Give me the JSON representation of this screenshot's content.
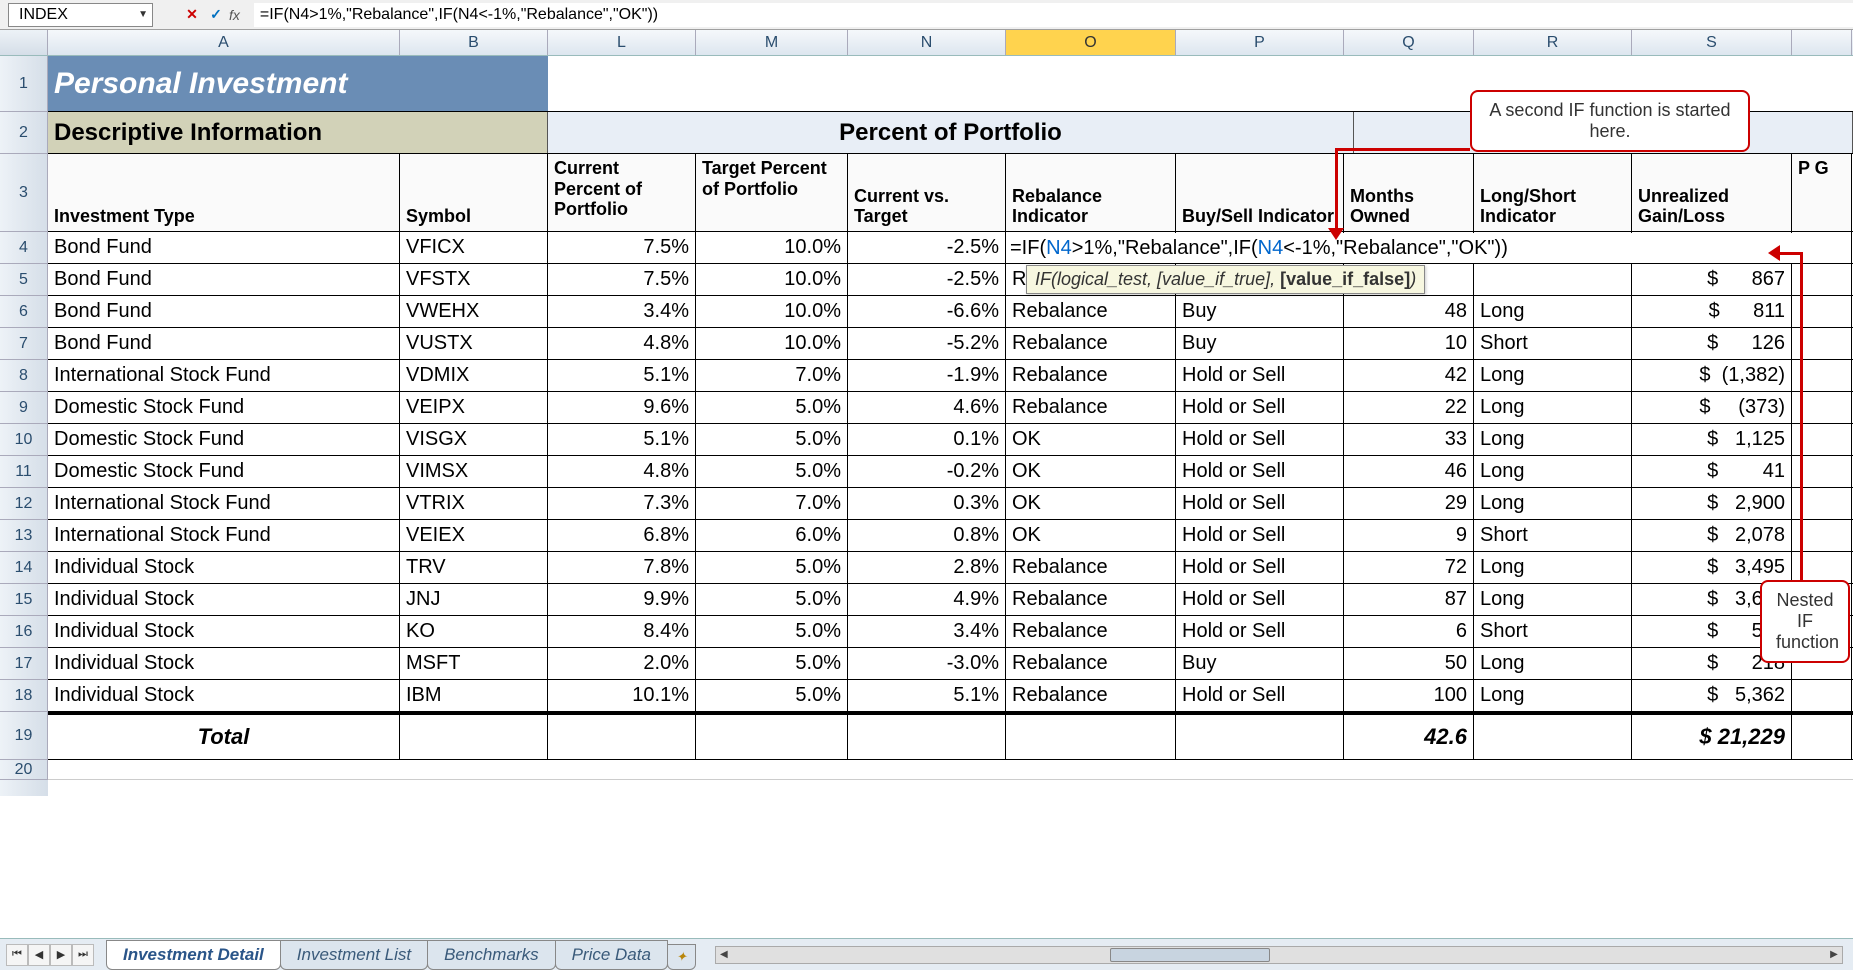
{
  "nameBox": "INDEX",
  "formula": "=IF(N4>1%,\"Rebalance\",IF(N4<-1%,\"Rebalance\",\"OK\"))",
  "tooltip": {
    "prefix": "IF(logical_test, [value_if_true], ",
    "bold": "[value_if_false]",
    "suffix": ")"
  },
  "callout1": "A second IF function is started here.",
  "callout2_l1": "Nested IF",
  "callout2_l2": "function",
  "sheets": {
    "s1": "Investment Detail",
    "s2": "Investment List",
    "s3": "Benchmarks",
    "s4": "Price Data"
  },
  "cols": {
    "A": "A",
    "B": "B",
    "L": "L",
    "M": "M",
    "N": "N",
    "O": "O",
    "P": "P",
    "Q": "Q",
    "R": "R",
    "S": "S"
  },
  "rows": {
    "r1": "1",
    "r2": "2",
    "r3": "3",
    "r4": "4",
    "r5": "5",
    "r6": "6",
    "r7": "7",
    "r8": "8",
    "r9": "9",
    "r10": "10",
    "r11": "11",
    "r12": "12",
    "r13": "13",
    "r14": "14",
    "r15": "15",
    "r16": "16",
    "r17": "17",
    "r18": "18",
    "r19": "19",
    "r20": "20"
  },
  "title": "Personal Investment",
  "sec1": "Descriptive Information",
  "sec2": "Percent of Portfolio",
  "hdr": {
    "A": "Investment Type",
    "B": "Symbol",
    "L": "Current Percent of Portfolio",
    "M": "Target Percent of Portfolio",
    "N": "Current vs. Target",
    "O": "Rebalance Indicator",
    "P": "Buy/Sell Indicator",
    "Q": "Months Owned",
    "R": "Long/Short Indicator",
    "S": "Unrealized Gain/Loss",
    "T": "P G"
  },
  "data": [
    {
      "A": "Bond Fund",
      "B": "VFICX",
      "L": "7.5%",
      "M": "10.0%",
      "N": "-2.5%",
      "O": "",
      "P": "",
      "Q": "",
      "R": "",
      "S": ""
    },
    {
      "A": "Bond Fund",
      "B": "VFSTX",
      "L": "7.5%",
      "M": "10.0%",
      "N": "-2.5%",
      "O": "R",
      "P": "",
      "Q": "",
      "R": "",
      "S": "$      867"
    },
    {
      "A": "Bond Fund",
      "B": "VWEHX",
      "L": "3.4%",
      "M": "10.0%",
      "N": "-6.6%",
      "O": "Rebalance",
      "P": "Buy",
      "Q": "48",
      "R": "Long",
      "S": "$      811"
    },
    {
      "A": "Bond Fund",
      "B": "VUSTX",
      "L": "4.8%",
      "M": "10.0%",
      "N": "-5.2%",
      "O": "Rebalance",
      "P": "Buy",
      "Q": "10",
      "R": "Short",
      "S": "$      126"
    },
    {
      "A": "International Stock Fund",
      "B": "VDMIX",
      "L": "5.1%",
      "M": "7.0%",
      "N": "-1.9%",
      "O": "Rebalance",
      "P": "Hold or Sell",
      "Q": "42",
      "R": "Long",
      "S": "$  (1,382)"
    },
    {
      "A": "Domestic Stock Fund",
      "B": "VEIPX",
      "L": "9.6%",
      "M": "5.0%",
      "N": "4.6%",
      "O": "Rebalance",
      "P": "Hold or Sell",
      "Q": "22",
      "R": "Long",
      "S": "$     (373)"
    },
    {
      "A": "Domestic Stock Fund",
      "B": "VISGX",
      "L": "5.1%",
      "M": "5.0%",
      "N": "0.1%",
      "O": "OK",
      "P": "Hold or Sell",
      "Q": "33",
      "R": "Long",
      "S": "$   1,125"
    },
    {
      "A": "Domestic Stock Fund",
      "B": "VIMSX",
      "L": "4.8%",
      "M": "5.0%",
      "N": "-0.2%",
      "O": "OK",
      "P": "Hold or Sell",
      "Q": "46",
      "R": "Long",
      "S": "$        41"
    },
    {
      "A": "International Stock Fund",
      "B": "VTRIX",
      "L": "7.3%",
      "M": "7.0%",
      "N": "0.3%",
      "O": "OK",
      "P": "Hold or Sell",
      "Q": "29",
      "R": "Long",
      "S": "$   2,900"
    },
    {
      "A": "International Stock Fund",
      "B": "VEIEX",
      "L": "6.8%",
      "M": "6.0%",
      "N": "0.8%",
      "O": "OK",
      "P": "Hold or Sell",
      "Q": "9",
      "R": "Short",
      "S": "$   2,078"
    },
    {
      "A": "Individual Stock",
      "B": "TRV",
      "L": "7.8%",
      "M": "5.0%",
      "N": "2.8%",
      "O": "Rebalance",
      "P": "Hold or Sell",
      "Q": "72",
      "R": "Long",
      "S": "$   3,495"
    },
    {
      "A": "Individual Stock",
      "B": "JNJ",
      "L": "9.9%",
      "M": "5.0%",
      "N": "4.9%",
      "O": "Rebalance",
      "P": "Hold or Sell",
      "Q": "87",
      "R": "Long",
      "S": "$   3,676"
    },
    {
      "A": "Individual Stock",
      "B": "KO",
      "L": "8.4%",
      "M": "5.0%",
      "N": "3.4%",
      "O": "Rebalance",
      "P": "Hold or Sell",
      "Q": "6",
      "R": "Short",
      "S": "$      588"
    },
    {
      "A": "Individual Stock",
      "B": "MSFT",
      "L": "2.0%",
      "M": "5.0%",
      "N": "-3.0%",
      "O": "Rebalance",
      "P": "Buy",
      "Q": "50",
      "R": "Long",
      "S": "$      218"
    },
    {
      "A": "Individual Stock",
      "B": "IBM",
      "L": "10.1%",
      "M": "5.0%",
      "N": "5.1%",
      "O": "Rebalance",
      "P": "Hold or Sell",
      "Q": "100",
      "R": "Long",
      "S": "$   5,362"
    }
  ],
  "total": {
    "label": "Total",
    "Q": "42.6",
    "S": "$ 21,229"
  },
  "editFormula": {
    "p1": "=IF(",
    "p2": "N4",
    "p3": ">1%,\"Rebalance\",IF(",
    "p4": "N4",
    "p5": "<-1%,\"Rebalance\",\"OK\"))"
  }
}
